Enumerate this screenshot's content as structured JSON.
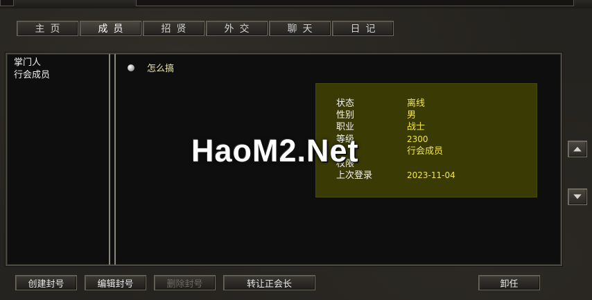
{
  "tabs": [
    {
      "label": "主页",
      "active": false
    },
    {
      "label": "成员",
      "active": true
    },
    {
      "label": "招贤",
      "active": false
    },
    {
      "label": "外交",
      "active": false
    },
    {
      "label": "聊天",
      "active": false
    },
    {
      "label": "日记",
      "active": false
    }
  ],
  "roles": [
    "掌门人",
    "行会成员"
  ],
  "members": [
    {
      "name": "怎么搞",
      "status_icon": "grey-dot-icon"
    }
  ],
  "info": {
    "rows": [
      {
        "label": "状态",
        "value": "离线"
      },
      {
        "label": "性别",
        "value": "男"
      },
      {
        "label": "职业",
        "value": "战士"
      },
      {
        "label": "等级",
        "value": "2300"
      },
      {
        "label": "",
        "value": "行会成员"
      },
      {
        "label": "权限",
        "value": ""
      },
      {
        "label": "上次登录",
        "value": "2023-11-04"
      }
    ]
  },
  "watermark": "HaoM2.Net",
  "scroll": {
    "up_icon": "arrow-up-icon",
    "down_icon": "arrow-down-icon"
  },
  "buttons": {
    "create_title": "创建封号",
    "edit_title": "编辑封号",
    "delete_title": "删除封号",
    "transfer_leader": "转让正会长",
    "resign": "卸任"
  },
  "colors": {
    "info_bg": "#3a3a04",
    "info_value": "#f0e64a",
    "member_name": "#e8e6a8",
    "panel_bg": "#0e0e0e"
  }
}
